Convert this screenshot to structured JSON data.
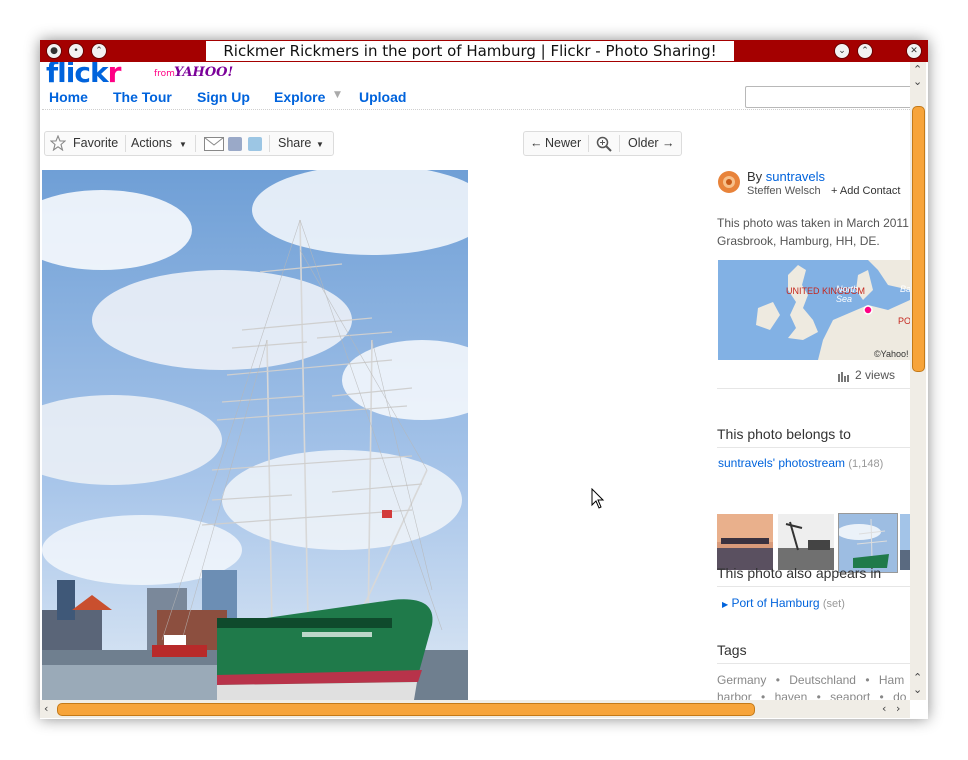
{
  "window": {
    "title": "Rickmer Rickmers in the port of Hamburg | Flickr - Photo Sharing!"
  },
  "header": {
    "logo_main": "flick",
    "logo_r": "r",
    "logo_from": "from",
    "logo_yahoo": "YAHOO!",
    "nav": [
      "Home",
      "The Tour",
      "Sign Up",
      "Explore",
      "Upload"
    ],
    "search_placeholder": ""
  },
  "toolbar": {
    "favorite": "Favorite",
    "actions": "Actions",
    "share": "Share",
    "newer": "Newer",
    "older": "Older"
  },
  "sidebar": {
    "by_prefix": "By",
    "author_link": "suntravels",
    "author_name": "Steffen Welsch",
    "add_contact": "+ Add Contact",
    "taken_line1": "This photo was taken in March 2011",
    "taken_line2": "Grasbrook, Hamburg, HH, DE.",
    "map_labels": {
      "uk": "UNITED KINGDOM",
      "sea": "North Sea",
      "pol": "PO",
      "ba": "Ba",
      "copyright": "©Yahoo!"
    },
    "views": "2 views",
    "belongs_heading": "This photo belongs to",
    "photostream_link": "suntravels' photostream",
    "photostream_count": "(1,148)",
    "appears_heading": "This photo also appears in",
    "set_link": "Port of Hamburg",
    "set_suffix": "(set)",
    "tags_heading": "Tags",
    "tags_row1": [
      "Germany",
      "Deutschland",
      "Ham"
    ],
    "tags_row2": [
      "harbor",
      "haven",
      "seaport",
      "do"
    ]
  },
  "colors": {
    "titlebar": "#a40000",
    "flickr_blue": "#0063dc",
    "flickr_pink": "#ff0084",
    "scrollbar_thumb": "#f7a43a",
    "ship_hull": "#1f7a4a"
  }
}
